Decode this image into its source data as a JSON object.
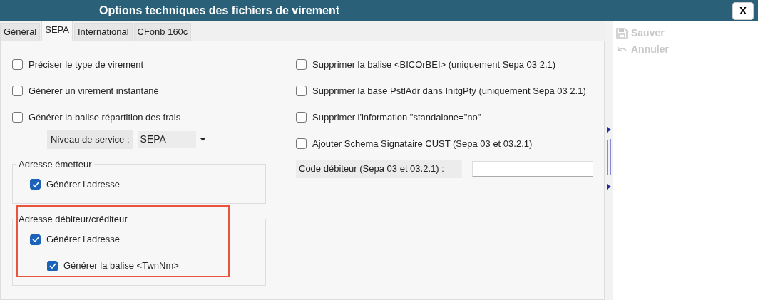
{
  "window": {
    "title": "Options techniques des fichiers de virement",
    "close_button": "X"
  },
  "tabs": [
    {
      "label": "Général",
      "selected": false
    },
    {
      "label": "SEPA",
      "selected": true
    },
    {
      "label": "International",
      "selected": false
    },
    {
      "label": "CFonb 160c",
      "selected": false
    }
  ],
  "left_options": [
    {
      "label": "Préciser le type de virement",
      "checked": false
    },
    {
      "label": "Générer un virement instantané",
      "checked": false
    },
    {
      "label": "Générer la balise répartition des frais",
      "checked": false
    }
  ],
  "service_level": {
    "label": "Niveau de service :",
    "value": "SEPA"
  },
  "groups": [
    {
      "title": "Adresse émetteur",
      "highlighted": false,
      "options": [
        {
          "label": "Générer l'adresse",
          "checked": true
        }
      ]
    },
    {
      "title": "Adresse débiteur/créditeur",
      "highlighted": true,
      "options": [
        {
          "label": "Générer l'adresse",
          "checked": true,
          "children": [
            {
              "label": "Générer la balise <TwnNm>",
              "checked": true
            }
          ]
        }
      ]
    }
  ],
  "right_options": [
    {
      "label": "Supprimer la balise <BICOrBEI> (uniquement Sepa 03 2.1)",
      "checked": false
    },
    {
      "label": "Supprimer la base PstlAdr dans InitgPty (uniquement Sepa 03 2.1)",
      "checked": false
    },
    {
      "label": "Supprimer l'information \"standalone=\"no\"",
      "checked": false
    },
    {
      "label": "Ajouter Schema Signataire CUST (Sepa 03 et 03.2.1)",
      "checked": false
    }
  ],
  "debtor_code": {
    "label": "Code débiteur (Sepa 03 et 03.2.1) :"
  },
  "toolbar": [
    {
      "kind": "save",
      "label": "Sauver",
      "disabled": true
    },
    {
      "kind": "undo",
      "label": "Annuler",
      "disabled": true
    }
  ]
}
